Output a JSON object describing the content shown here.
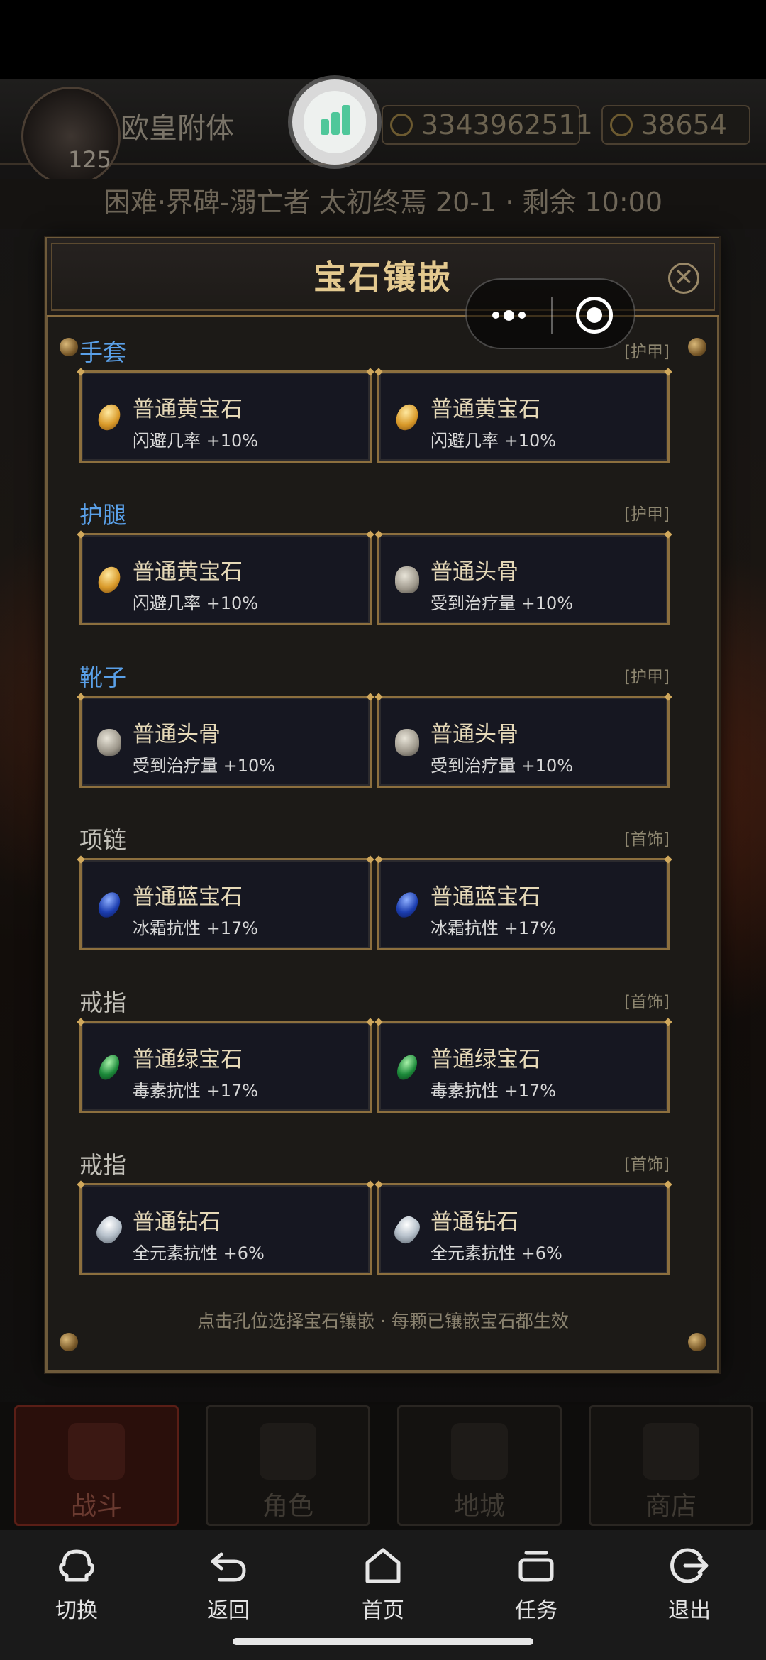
{
  "game": {
    "player_name": "欧皇附体",
    "level": "125",
    "gold": "3343962511",
    "energy": "38654",
    "status_line": "困难·界碑-溺亡者  太初终焉 20-1 · 剩余 10:00",
    "tabs": [
      "战斗",
      "角色",
      "地城",
      "商店"
    ]
  },
  "dialog": {
    "title": "宝石镶嵌",
    "close_label": "✕",
    "footer": "点击孔位选择宝石镶嵌 · 每颗已镶嵌宝石都生效",
    "sections": [
      {
        "title": "手套",
        "tag": "[护甲]",
        "slots": [
          {
            "icon": "yellow-gem-icon",
            "name": "普通黄宝石",
            "effect": "闪避几率 +10%"
          },
          {
            "icon": "yellow-gem-icon",
            "name": "普通黄宝石",
            "effect": "闪避几率 +10%"
          }
        ]
      },
      {
        "title": "护腿",
        "tag": "[护甲]",
        "slots": [
          {
            "icon": "yellow-gem-icon",
            "name": "普通黄宝石",
            "effect": "闪避几率 +10%"
          },
          {
            "icon": "skull-icon",
            "name": "普通头骨",
            "effect": "受到治疗量 +10%"
          }
        ]
      },
      {
        "title": "靴子",
        "tag": "[护甲]",
        "slots": [
          {
            "icon": "skull-icon",
            "name": "普通头骨",
            "effect": "受到治疗量 +10%"
          },
          {
            "icon": "skull-icon",
            "name": "普通头骨",
            "effect": "受到治疗量 +10%"
          }
        ]
      },
      {
        "title": "项链",
        "tag": "[首饰]",
        "slots": [
          {
            "icon": "blue-gem-icon",
            "name": "普通蓝宝石",
            "effect": "冰霜抗性 +17%"
          },
          {
            "icon": "blue-gem-icon",
            "name": "普通蓝宝石",
            "effect": "冰霜抗性 +17%"
          }
        ]
      },
      {
        "title": "戒指",
        "tag": "[首饰]",
        "slots": [
          {
            "icon": "green-gem-icon",
            "name": "普通绿宝石",
            "effect": "毒素抗性 +17%"
          },
          {
            "icon": "green-gem-icon",
            "name": "普通绿宝石",
            "effect": "毒素抗性 +17%"
          }
        ]
      },
      {
        "title": "戒指",
        "tag": "[首饰]",
        "slots": [
          {
            "icon": "diamond-icon",
            "name": "普通钻石",
            "effect": "全元素抗性 +6%"
          },
          {
            "icon": "diamond-icon",
            "name": "普通钻石",
            "effect": "全元素抗性 +6%"
          }
        ]
      }
    ]
  },
  "system_nav": [
    {
      "icon": "switch-icon",
      "label": "切换"
    },
    {
      "icon": "back-icon",
      "label": "返回"
    },
    {
      "icon": "home-icon",
      "label": "首页"
    },
    {
      "icon": "tasks-icon",
      "label": "任务"
    },
    {
      "icon": "exit-icon",
      "label": "退出"
    }
  ],
  "colors": {
    "accent_gold": "#e3c98f",
    "section_blue": "#5aa0e8",
    "card_border": "#8c6f3e"
  }
}
